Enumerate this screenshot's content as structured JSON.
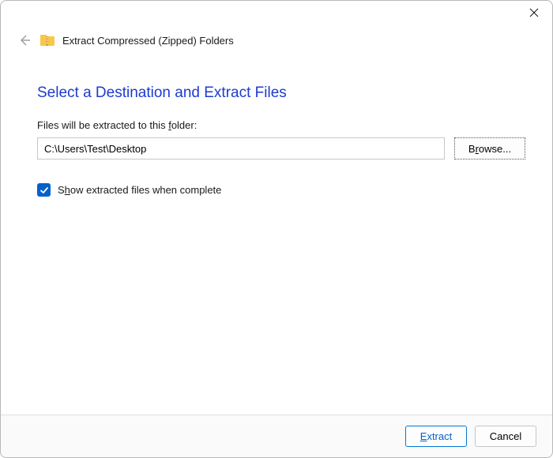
{
  "wizard_title": "Extract Compressed (Zipped) Folders",
  "heading": "Select a Destination and Extract Files",
  "field_label_pre": "Files will be extracted to this ",
  "field_label_accel": "f",
  "field_label_post": "older:",
  "path_value": "C:\\Users\\Test\\Desktop",
  "browse_accel": "r",
  "browse_pre": "B",
  "browse_post": "owse...",
  "checkbox_pre": "S",
  "checkbox_accel": "h",
  "checkbox_post": "ow extracted files when complete",
  "checkbox_checked": true,
  "extract_accel": "E",
  "extract_post": "xtract",
  "cancel_label": "Cancel"
}
